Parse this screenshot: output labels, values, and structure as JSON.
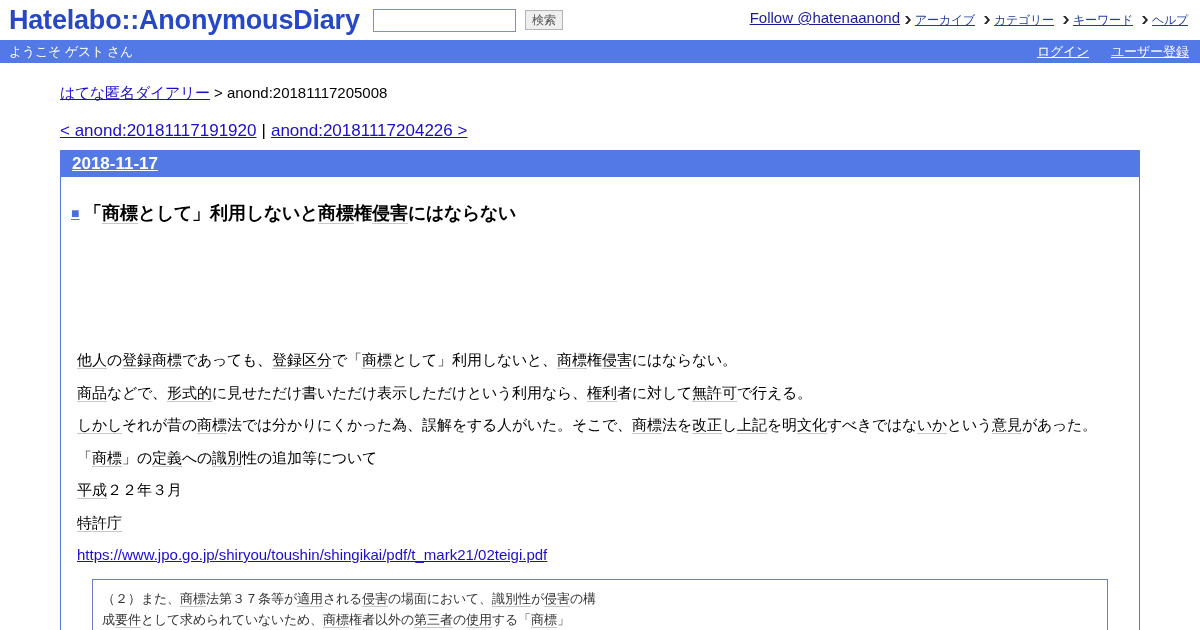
{
  "header": {
    "logo": "Hatelabo::AnonymousDiary",
    "search": {
      "button": "検索"
    },
    "follow_link": "Follow @hatenaanond",
    "nav": [
      "アーカイブ",
      "カテゴリー",
      "キーワード",
      "ヘルプ"
    ]
  },
  "user_bar": {
    "greeting": "ようこそ ゲスト さん",
    "links": [
      "ログイン",
      "ユーザー登録"
    ]
  },
  "breadcrumb": {
    "home": "はてな匿名ダイアリー",
    "current": "> anond:20181117205008"
  },
  "pager": {
    "prev": "< anond:20181117191920",
    "separator": "|",
    "next": "anond:20181117204226 >"
  },
  "day": {
    "date": "2018-11-17",
    "section": {
      "anchor": "■",
      "title": [
        {
          "text": "「",
          "keyword": false
        },
        {
          "text": "商標",
          "keyword": true
        },
        {
          "text": "として」利用しないと",
          "keyword": false
        },
        {
          "text": "商標",
          "keyword": true
        },
        {
          "text": "権",
          "keyword": false
        },
        {
          "text": "侵害",
          "keyword": true
        },
        {
          "text": "にはならない",
          "keyword": false
        }
      ],
      "paragraphs": [
        {
          "kind": "text",
          "segments": [
            {
              "text": "他人",
              "keyword": true
            },
            {
              "text": "の",
              "keyword": false
            },
            {
              "text": "登録商標",
              "keyword": true
            },
            {
              "text": "であっても、",
              "keyword": false
            },
            {
              "text": "登録区分",
              "keyword": true
            },
            {
              "text": "で「",
              "keyword": false
            },
            {
              "text": "商標",
              "keyword": true
            },
            {
              "text": "として」利用しないと、",
              "keyword": false
            },
            {
              "text": "商標",
              "keyword": true
            },
            {
              "text": "権",
              "keyword": false
            },
            {
              "text": "侵害",
              "keyword": true
            },
            {
              "text": "にはならない。",
              "keyword": false
            }
          ]
        },
        {
          "kind": "text",
          "segments": [
            {
              "text": "商品",
              "keyword": true
            },
            {
              "text": "などで、",
              "keyword": false
            },
            {
              "text": "形式的",
              "keyword": true
            },
            {
              "text": "に見せただけ書いただけ表示しただけという利用なら、",
              "keyword": false
            },
            {
              "text": "権利",
              "keyword": true
            },
            {
              "text": "者に対して",
              "keyword": false
            },
            {
              "text": "無許可",
              "keyword": true
            },
            {
              "text": "で行える。",
              "keyword": false
            }
          ]
        },
        {
          "kind": "text",
          "segments": [
            {
              "text": "しかし",
              "keyword": true
            },
            {
              "text": "それが昔の",
              "keyword": false
            },
            {
              "text": "商標",
              "keyword": true
            },
            {
              "text": "法では分かりにくかった為、誤解をする人がいた。そこで、",
              "keyword": false
            },
            {
              "text": "商標",
              "keyword": true
            },
            {
              "text": "法を",
              "keyword": false
            },
            {
              "text": "改正",
              "keyword": true
            },
            {
              "text": "し",
              "keyword": false
            },
            {
              "text": "上記",
              "keyword": true
            },
            {
              "text": "を明",
              "keyword": false
            },
            {
              "text": "文化",
              "keyword": true
            },
            {
              "text": "すべきではな",
              "keyword": false
            },
            {
              "text": "いか",
              "keyword": true
            },
            {
              "text": "という",
              "keyword": false
            },
            {
              "text": "意見",
              "keyword": true
            },
            {
              "text": "があった。",
              "keyword": false
            }
          ]
        },
        {
          "kind": "text",
          "segments": [
            {
              "text": "「",
              "keyword": false
            },
            {
              "text": "商標",
              "keyword": true
            },
            {
              "text": "」の",
              "keyword": false
            },
            {
              "text": "定義",
              "keyword": true
            },
            {
              "text": "への",
              "keyword": false
            },
            {
              "text": "識別",
              "keyword": true
            },
            {
              "text": "性の追加等について",
              "keyword": false
            }
          ]
        },
        {
          "kind": "text",
          "segments": [
            {
              "text": "平成",
              "keyword": true
            },
            {
              "text": "２２年３月",
              "keyword": false
            }
          ]
        },
        {
          "kind": "text",
          "segments": [
            {
              "text": "特許庁",
              "keyword": true
            }
          ]
        },
        {
          "kind": "link",
          "text": "https://www.jpo.go.jp/shiryou/toushin/shingikai/pdf/t_mark21/02teigi.pdf"
        }
      ],
      "blockquote": {
        "lines": [
          [
            {
              "text": "（２）また、",
              "keyword": false
            },
            {
              "text": "商標",
              "keyword": true
            },
            {
              "text": "法第３７条等が",
              "keyword": false
            },
            {
              "text": "適用",
              "keyword": true
            },
            {
              "text": "される",
              "keyword": false
            },
            {
              "text": "侵害",
              "keyword": true
            },
            {
              "text": "の場面において、",
              "keyword": false
            },
            {
              "text": "識別性",
              "keyword": true
            },
            {
              "text": "が",
              "keyword": false
            },
            {
              "text": "侵害",
              "keyword": true
            },
            {
              "text": "の構",
              "keyword": false
            }
          ],
          [
            {
              "text": "成",
              "keyword": false
            },
            {
              "text": "要件",
              "keyword": true
            },
            {
              "text": "として求められていないため、",
              "keyword": false
            },
            {
              "text": "商標",
              "keyword": true
            },
            {
              "text": "権者以外の",
              "keyword": false
            },
            {
              "text": "第三者",
              "keyword": true
            },
            {
              "text": "の",
              "keyword": false
            },
            {
              "text": "使用",
              "keyword": true
            },
            {
              "text": "する「",
              "keyword": false
            },
            {
              "text": "商標",
              "keyword": true
            },
            {
              "text": "」",
              "keyword": false
            }
          ]
        ]
      }
    }
  }
}
